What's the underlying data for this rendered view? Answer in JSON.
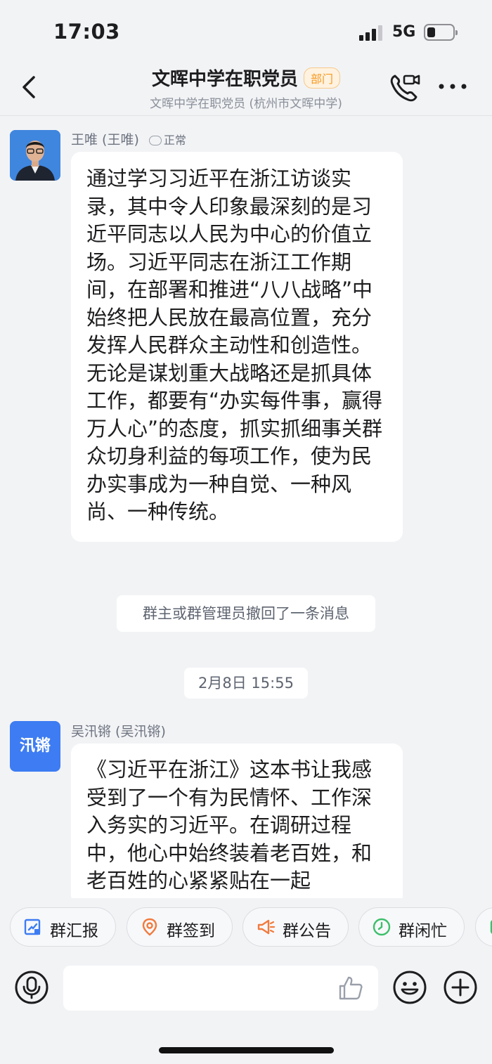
{
  "status_bar": {
    "time": "17:03",
    "network": "5G"
  },
  "header": {
    "title": "文晖中学在职党员",
    "badge": "部门",
    "subtitle": "文晖中学在职党员 (杭州市文晖中学)"
  },
  "messages": [
    {
      "sender": "王唯 (王唯)",
      "status": "正常",
      "text": "通过学习习近平在浙江访谈实录，其中令人印象最深刻的是习近平同志以人民为中心的价值立场。习近平同志在浙江工作期间，在部署和推进“八八战略”中始终把人民放在最高位置，充分发挥人民群众主动性和创造性。无论是谋划重大战略还是抓具体工作，都要有“办实每件事，赢得万人心”的态度，抓实抓细事关群众切身利益的每项工作，使为民办实事成为一种自觉、一种风尚、一种传统。"
    },
    {
      "sender": "吴汛锵 (吴汛锵)",
      "avatar_text": "汛锵",
      "text": "《习近平在浙江》这本书让我感受到了一个有为民情怀、工作深入务实的习近平。在调研过程中，他心中始终装着老百姓，和老百姓的心紧紧贴在一起"
    }
  ],
  "system_notice": "群主或群管理员撤回了一条消息",
  "timestamp": "2月8日 15:55",
  "quick_actions": [
    "群汇报",
    "群签到",
    "群公告",
    "群闲忙"
  ],
  "icons": {
    "back": "chevron-left-icon",
    "call": "phone-video-icon",
    "more": "more-dots-icon",
    "voice": "microphone-icon",
    "like": "thumbs-up-icon",
    "emoji": "smiley-icon",
    "plus": "plus-icon"
  },
  "colors": {
    "accent": "#3d7cf2",
    "badge_orange": "#f59a23",
    "background": "#f2f3f5"
  }
}
